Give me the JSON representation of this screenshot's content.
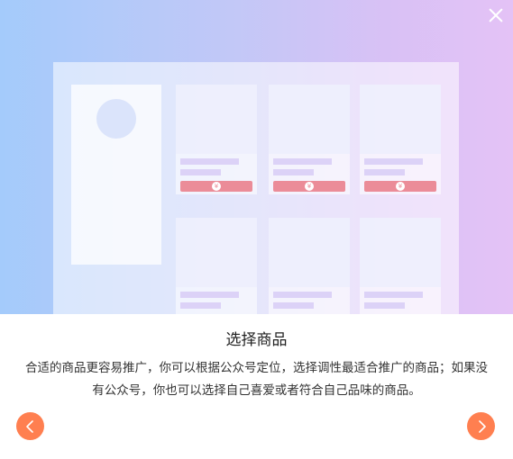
{
  "dialog": {
    "title": "选择商品",
    "description": "合适的商品更容易推广，你可以根据公众号定位，选择调性最适合推广的商品；如果没有公众号，你也可以选择自己喜爱或者符合自己品味的商品。",
    "close_icon": "close-icon",
    "prev_icon": "chevron-left-icon",
    "next_icon": "chevron-right-icon",
    "accent_color": "#ff7f50"
  },
  "illustration": {
    "currency_symbol": "¥",
    "price_color": "#eb8c98"
  }
}
